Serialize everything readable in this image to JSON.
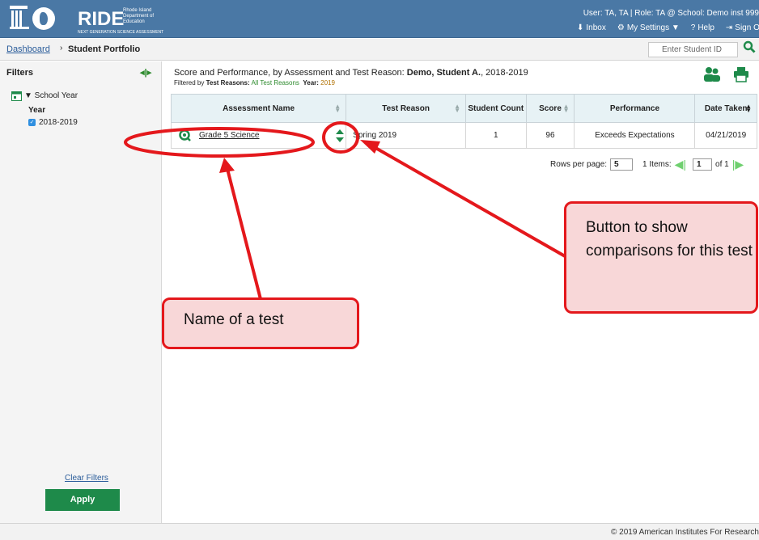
{
  "header": {
    "logo_text": "RIDE",
    "logo_small": "Rhode Island Department of Education",
    "logo_subtitle": "NEXT GENERATION SCIENCE ASSESSMENT",
    "user_line": "User: TA, TA  |  Role: TA @ School: Demo inst 999",
    "links": {
      "inbox": "Inbox",
      "settings": "My Settings ▼",
      "help": "Help",
      "signout": "Sign Ou"
    }
  },
  "breadcrumb": {
    "dashboard": "Dashboard",
    "sep": "›",
    "current": "Student Portfolio"
  },
  "search": {
    "placeholder": "Enter Student ID"
  },
  "filters": {
    "title": "Filters",
    "school_year": "▼ School Year",
    "year_label": "Year",
    "year_value": "2018-2019",
    "clear": "Clear Filters",
    "apply": "Apply"
  },
  "report": {
    "title_prefix": "Score and Performance, by Assessment and Test Reason: ",
    "student": "Demo, Student A.",
    "title_suffix": ", 2018-2019",
    "filtered_prefix": "Filtered by ",
    "tr_label": "Test Reasons:",
    "tr_value": "All Test Reasons",
    "yr_label": "Year:",
    "yr_value": "2019"
  },
  "table": {
    "headers": [
      "Assessment Name",
      "Test Reason",
      "Student Count",
      "Score",
      "Performance",
      "Date Taken"
    ],
    "row": {
      "name": "Grade 5 Science",
      "reason": "Spring 2019",
      "count": "1",
      "score": "96",
      "performance": "Exceeds Expectations",
      "date": "04/21/2019"
    }
  },
  "pager": {
    "rows_label": "Rows per page:",
    "rows_value": "5",
    "items": "1 Items:",
    "page": "1",
    "of": "of 1"
  },
  "footer": {
    "copyright": "© 2019 American Institutes For Research"
  },
  "callouts": {
    "comparisons": "Button to show comparisons for this test",
    "name": "Name of a test"
  },
  "colors": {
    "header": "#4a78a5",
    "apply": "#1e8a4a",
    "annotation": "#e4181c"
  }
}
